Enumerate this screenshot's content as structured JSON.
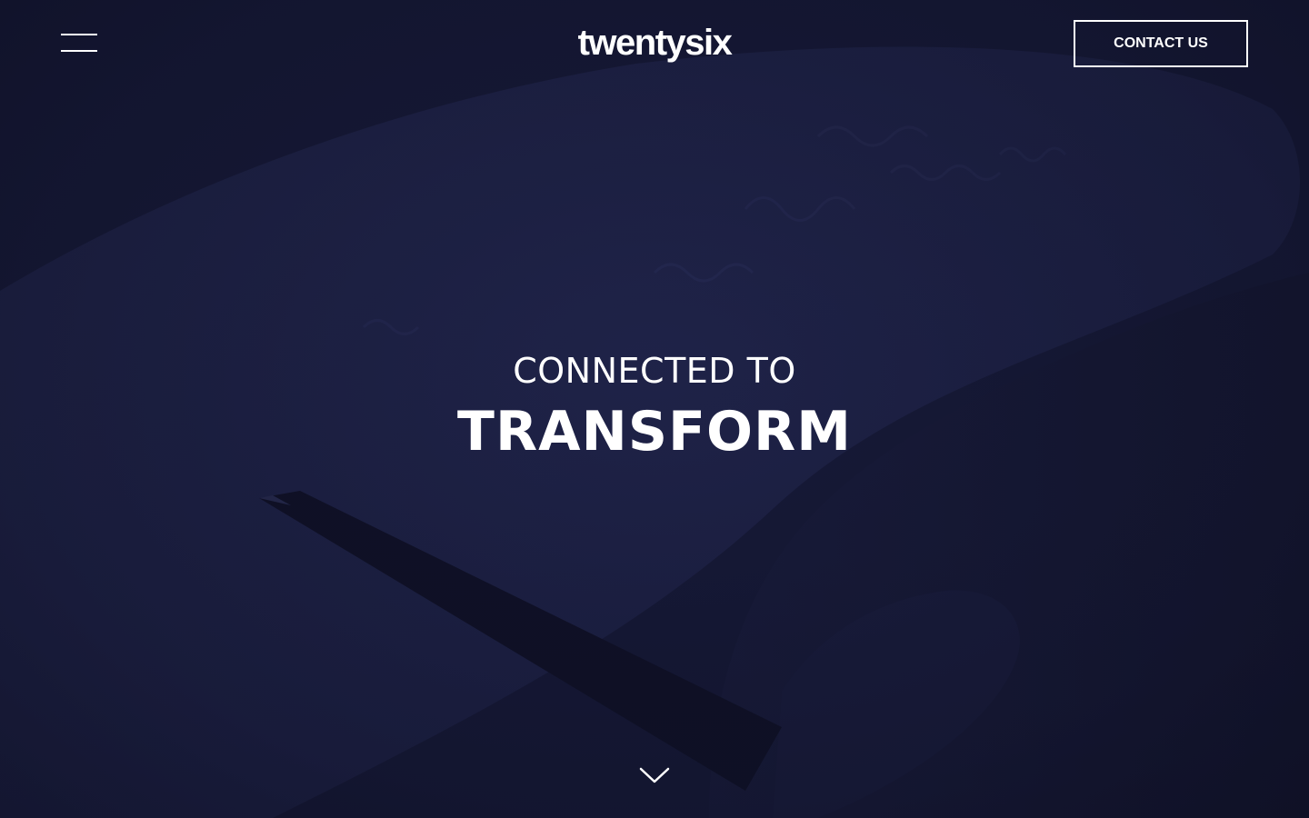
{
  "header": {
    "logo_text": "twentysix",
    "contact_label": "CONTACT US"
  },
  "hero": {
    "headline_line1": "CONNECTED TO",
    "headline_line2": "TRANSFORM"
  },
  "icons": {
    "menu": "hamburger-menu-icon",
    "scroll": "chevron-down-icon"
  },
  "colors": {
    "background": "#171a38",
    "text": "#ffffff"
  }
}
